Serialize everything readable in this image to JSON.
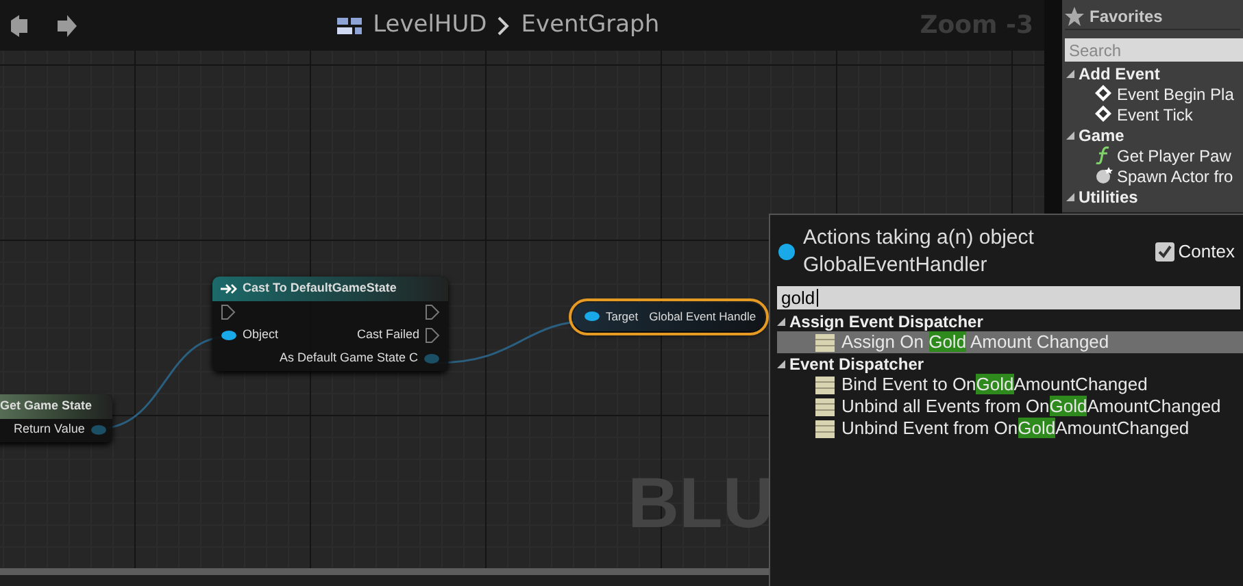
{
  "graph": {
    "breadcrumb": [
      "LevelHUD",
      "EventGraph"
    ],
    "zoom": "Zoom -3",
    "watermark": "BLU",
    "nodes": [
      {
        "kind": "pure",
        "title": "Get Game State",
        "selected": false,
        "outputs": [
          {
            "kind": "data",
            "label": "Return Value"
          }
        ]
      },
      {
        "kind": "cast",
        "title": "Cast To DefaultGameState",
        "selected": false,
        "inputs": [
          {
            "kind": "exec"
          },
          {
            "kind": "data",
            "label": "Object"
          }
        ],
        "outputs": [
          {
            "kind": "exec"
          },
          {
            "kind": "exec",
            "label": "Cast Failed"
          },
          {
            "kind": "data",
            "label": "As Default Game State C"
          }
        ]
      },
      {
        "kind": "compact",
        "title": "Global Event Handle",
        "selected": true,
        "inputs": [
          {
            "kind": "data",
            "label": "Target"
          }
        ]
      }
    ]
  },
  "palette": {
    "title": "Favorites",
    "search": {
      "placeholder": "Search"
    },
    "categories": [
      {
        "label": "Add Event",
        "expanded": true,
        "children": [
          {
            "kind": "event",
            "label": "Event Begin Pla"
          },
          {
            "kind": "event",
            "label": "Event Tick"
          }
        ]
      },
      {
        "label": "Game",
        "expanded": true,
        "children": [
          {
            "kind": "function",
            "label": "Get Player Paw"
          },
          {
            "kind": "spawn",
            "label": "Spawn Actor fro"
          }
        ]
      },
      {
        "label": "Utilities",
        "expanded": true
      }
    ]
  },
  "action_menu": {
    "heading": "Actions taking a(n) object GlobalEventHandler",
    "context_checkbox": {
      "label": "Contex",
      "checked": true
    },
    "search": {
      "value": "gold"
    },
    "groups": [
      {
        "label": "Assign Event Dispatcher",
        "expanded": true,
        "items": [
          {
            "selected": true,
            "parts": [
              {
                "text": "Assign On "
              },
              {
                "text": "Gold",
                "match": true
              },
              {
                "text": " Amount Changed"
              }
            ]
          }
        ]
      },
      {
        "label": "Event Dispatcher",
        "expanded": true,
        "items": [
          {
            "selected": false,
            "parts": [
              {
                "text": "Bind Event to On"
              },
              {
                "text": "Gold",
                "match": true
              },
              {
                "text": "AmountChanged"
              }
            ]
          },
          {
            "selected": false,
            "parts": [
              {
                "text": "Unbind all Events from On"
              },
              {
                "text": "Gold",
                "match": true
              },
              {
                "text": "AmountChanged"
              }
            ]
          },
          {
            "selected": false,
            "parts": [
              {
                "text": "Unbind Event from On"
              },
              {
                "text": "Gold",
                "match": true
              },
              {
                "text": "AmountChanged"
              }
            ]
          }
        ]
      }
    ]
  }
}
